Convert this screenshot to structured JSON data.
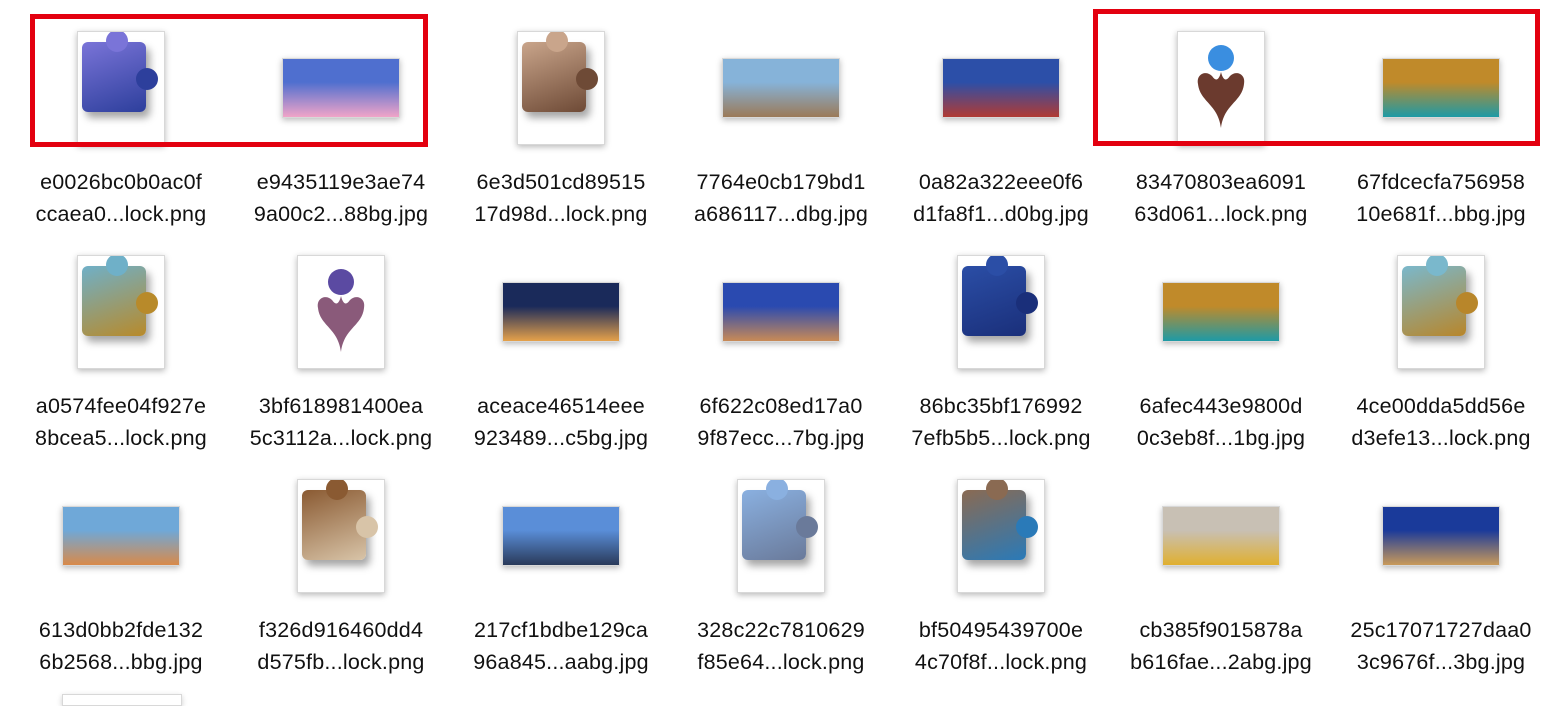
{
  "files": [
    {
      "line1": "e0026bc0b0ac0f",
      "line2": "ccaea0...lock.png",
      "kind": "puzzle",
      "c1": "#7a74d8",
      "c2": "#2d3f9c"
    },
    {
      "line1": "e9435119e3ae74",
      "line2": "9a00c2...88bg.jpg",
      "kind": "landscape",
      "c1": "#4f6fcf",
      "c2": "#f0a4c8"
    },
    {
      "line1": "6e3d501cd89515",
      "line2": "17d98d...lock.png",
      "kind": "puzzle",
      "c1": "#c9a58b",
      "c2": "#6e4a36"
    },
    {
      "line1": "7764e0cb179bd1",
      "line2": "a686117...dbg.jpg",
      "kind": "landscape",
      "c1": "#86b3d9",
      "c2": "#9b7a58"
    },
    {
      "line1": "0a82a322eee0f6",
      "line2": "d1fa8f1...d0bg.jpg",
      "kind": "landscape",
      "c1": "#2c4fa8",
      "c2": "#b13b34"
    },
    {
      "line1": "83470803ea6091",
      "line2": "63d061...lock.png",
      "kind": "fan",
      "c1": "#3a8ee0",
      "c2": "#6b3a2e"
    },
    {
      "line1": "67fdcecfa756958",
      "line2": "10e681f...bbg.jpg",
      "kind": "landscape",
      "c1": "#c08a2a",
      "c2": "#1e9aa6"
    },
    {
      "line1": "a0574fee04f927e",
      "line2": "8bcea5...lock.png",
      "kind": "puzzle",
      "c1": "#6fb0c8",
      "c2": "#b88a2a"
    },
    {
      "line1": "3bf618981400ea",
      "line2": "5c3112a...lock.png",
      "kind": "fan",
      "c1": "#5b4aa2",
      "c2": "#8a5a7a"
    },
    {
      "line1": "aceace46514eee",
      "line2": "923489...c5bg.jpg",
      "kind": "landscape",
      "c1": "#1a2a5a",
      "c2": "#e5a14a"
    },
    {
      "line1": "6f622c08ed17a0",
      "line2": "9f87ecc...7bg.jpg",
      "kind": "landscape",
      "c1": "#2a4ab0",
      "c2": "#c88a56"
    },
    {
      "line1": "86bc35bf176992",
      "line2": "7efb5b5...lock.png",
      "kind": "puzzle",
      "c1": "#2b4ea6",
      "c2": "#1a2f7a"
    },
    {
      "line1": "6afec443e9800d",
      "line2": "0c3eb8f...1bg.jpg",
      "kind": "landscape",
      "c1": "#c08a2a",
      "c2": "#1e9aa6"
    },
    {
      "line1": "4ce00dda5dd56e",
      "line2": "d3efe13...lock.png",
      "kind": "puzzle",
      "c1": "#7ab8cc",
      "c2": "#b8862a"
    },
    {
      "line1": "613d0bb2fde132",
      "line2": "6b2568...bbg.jpg",
      "kind": "landscape",
      "c1": "#6fa8d8",
      "c2": "#d98a4a"
    },
    {
      "line1": "f326d916460dd4",
      "line2": "d575fb...lock.png",
      "kind": "puzzle",
      "c1": "#8a5a32",
      "c2": "#d8c4a8"
    },
    {
      "line1": "217cf1bdbe129ca",
      "line2": "96a845...aabg.jpg",
      "kind": "landscape",
      "c1": "#5a8ed8",
      "c2": "#2a3a5a"
    },
    {
      "line1": "328c22c7810629",
      "line2": "f85e64...lock.png",
      "kind": "puzzle",
      "c1": "#8ab0e0",
      "c2": "#6a7a9a"
    },
    {
      "line1": "bf50495439700e",
      "line2": "4c70f8f...lock.png",
      "kind": "puzzle",
      "c1": "#8a6a52",
      "c2": "#2a7ab8"
    },
    {
      "line1": "cb385f9015878a",
      "line2": "b616fae...2abg.jpg",
      "kind": "landscape",
      "c1": "#c8c0b4",
      "c2": "#e0b030"
    },
    {
      "line1": "25c17071727daa0",
      "line2": "3c9676f...3bg.jpg",
      "kind": "landscape",
      "c1": "#1a3a9a",
      "c2": "#c89a5a"
    }
  ],
  "highlight_color": "#e3000f"
}
